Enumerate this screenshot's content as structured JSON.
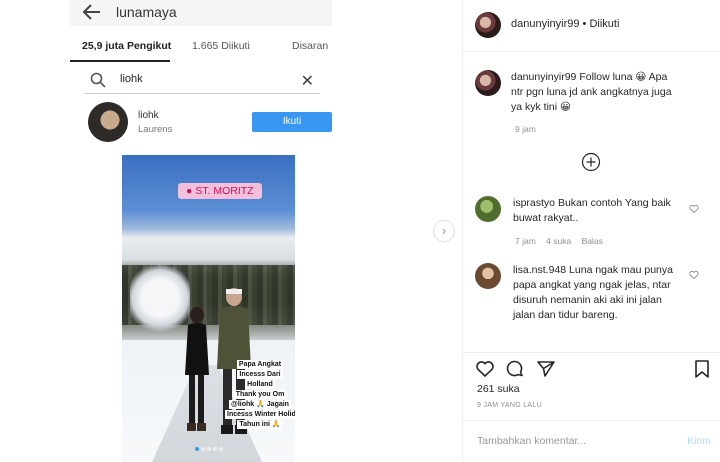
{
  "screenshot": {
    "profile_name": "lunamaya",
    "tabs": {
      "followers": "25,9 juta Pengikut",
      "following": "1.665 Diikuti",
      "suggested": "Disaran"
    },
    "search": {
      "value": "liohk",
      "placeholder": ""
    },
    "result": {
      "username": "liohk",
      "full_name": "Laurens",
      "follow_label": "Ikuti"
    },
    "story": {
      "location": "ST. MORITZ",
      "caption_lines": [
        "Papa Angkat",
        "Incesss Dari",
        "Holland",
        "Thank you Om",
        "@liohk 🙏 Jagain",
        "Incesss Winter Holiday",
        "Tahun ini 🙏"
      ]
    }
  },
  "post_header": {
    "username": "danunyinyir99",
    "separator": " • ",
    "follow_state": "Diikuti"
  },
  "caption": {
    "username": "danunyinyir99",
    "text": "Follow luna 😀 Apa ntr pgn luna jd ank angkatnya juga ya kyk tini 😀",
    "time": "9 jam"
  },
  "comments": [
    {
      "username": "isprastyo",
      "text": "Bukan contoh Yang baik buwat rakyat..",
      "time": "7 jam",
      "likes": "4 suka",
      "reply_label": "Balas"
    },
    {
      "username": "lisa.nst.948",
      "text": "Luna ngak mau punya papa angkat yang ngak jelas, ntar disuruh nemanin aki aki ini jalan jalan dan tidur bareng."
    }
  ],
  "likes_count": "261 suka",
  "timestamp": "9 JAM YANG LALU",
  "comment_box": {
    "placeholder": "Tambahkan komentar...",
    "post_label": "Kirim"
  },
  "colors": {
    "accent": "#3897f0",
    "post_disabled": "#b2dffc",
    "muted": "#8e8e8e"
  },
  "icons": [
    "back-arrow-icon",
    "search-icon",
    "close-icon",
    "location-pin-icon",
    "next-arrow-icon",
    "plus-circle-icon",
    "heart-icon",
    "comment-icon",
    "share-icon",
    "bookmark-icon"
  ]
}
